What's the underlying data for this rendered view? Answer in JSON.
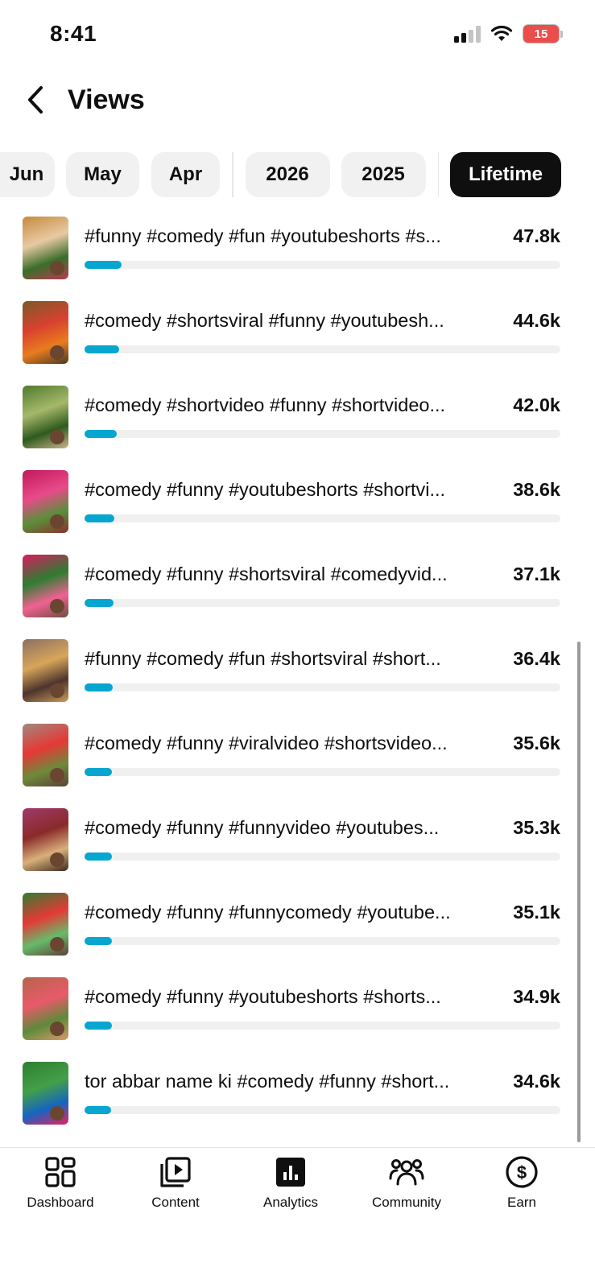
{
  "status": {
    "time": "8:41",
    "battery": "15"
  },
  "header": {
    "title": "Views"
  },
  "filters": [
    "Jun",
    "May",
    "Apr",
    "2026",
    "2025",
    "Lifetime"
  ],
  "active_filter": "Lifetime",
  "colors": {
    "accent_bar": "#06a6d1",
    "track": "#f0f0f0",
    "active_chip": "#0f0f0f"
  },
  "videos": [
    {
      "title": "#funny #comedy #fun #youtubeshorts #s...",
      "views": "47.8k",
      "bar_fraction": 0.078
    },
    {
      "title": "#comedy #shortsviral #funny #youtubesh...",
      "views": "44.6k",
      "bar_fraction": 0.073
    },
    {
      "title": "#comedy #shortvideo #funny #shortvideo...",
      "views": "42.0k",
      "bar_fraction": 0.068
    },
    {
      "title": "#comedy #funny #youtubeshorts #shortvi...",
      "views": "38.6k",
      "bar_fraction": 0.063
    },
    {
      "title": "#comedy #funny #shortsviral #comedyvid...",
      "views": "37.1k",
      "bar_fraction": 0.061
    },
    {
      "title": "#funny #comedy #fun #shortsviral #short...",
      "views": "36.4k",
      "bar_fraction": 0.059
    },
    {
      "title": "#comedy #funny #viralvideo #shortsvideo...",
      "views": "35.6k",
      "bar_fraction": 0.058
    },
    {
      "title": "#comedy #funny #funnyvideo #youtubes...",
      "views": "35.3k",
      "bar_fraction": 0.058
    },
    {
      "title": "#comedy #funny #funnycomedy #youtube...",
      "views": "35.1k",
      "bar_fraction": 0.057
    },
    {
      "title": "#comedy #funny #youtubeshorts #shorts...",
      "views": "34.9k",
      "bar_fraction": 0.057
    },
    {
      "title": "tor abbar name ki #comedy #funny #short...",
      "views": "34.6k",
      "bar_fraction": 0.056
    }
  ],
  "nav": [
    {
      "label": "Dashboard",
      "icon": "dashboard-icon"
    },
    {
      "label": "Content",
      "icon": "content-icon"
    },
    {
      "label": "Analytics",
      "icon": "analytics-icon"
    },
    {
      "label": "Community",
      "icon": "community-icon"
    },
    {
      "label": "Earn",
      "icon": "earn-icon"
    }
  ],
  "active_nav": "Analytics"
}
